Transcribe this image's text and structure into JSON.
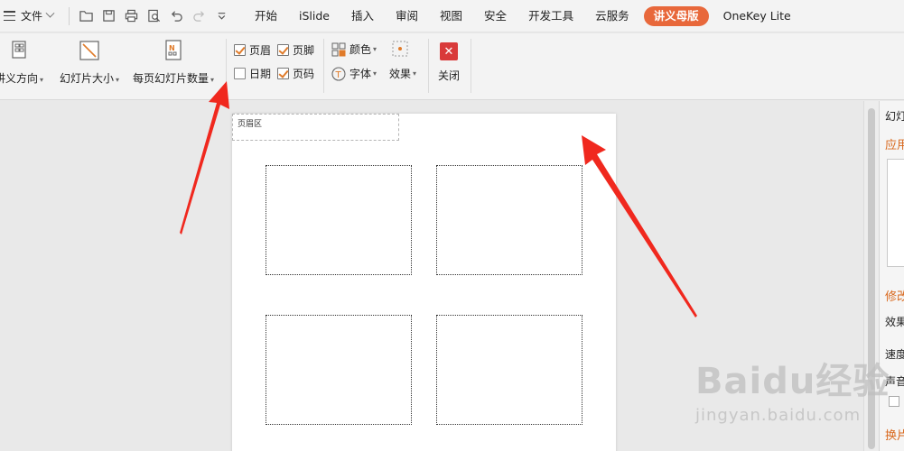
{
  "menubar": {
    "file_label": "文件",
    "quick_icons": [
      "folder-open-icon",
      "save-icon",
      "print-icon",
      "print-preview-icon",
      "undo-icon",
      "redo-icon",
      "customize-dropdown-icon"
    ],
    "tabs": [
      {
        "label": "开始",
        "active": false
      },
      {
        "label": "iSlide",
        "active": false
      },
      {
        "label": "插入",
        "active": false
      },
      {
        "label": "审阅",
        "active": false
      },
      {
        "label": "视图",
        "active": false
      },
      {
        "label": "安全",
        "active": false
      },
      {
        "label": "开发工具",
        "active": false
      },
      {
        "label": "云服务",
        "active": false
      },
      {
        "label": "讲义母版",
        "active": true
      },
      {
        "label": "OneKey Lite",
        "active": false
      }
    ],
    "active_tab_color": "#e8683b"
  },
  "ribbon": {
    "orientation_label": "讲义方向",
    "slide_size_label": "幻灯片大小",
    "slides_per_page_label": "每页幻灯片数量",
    "checkboxes": [
      {
        "label": "页眉",
        "checked": true
      },
      {
        "label": "页脚",
        "checked": true
      },
      {
        "label": "日期",
        "checked": false
      },
      {
        "label": "页码",
        "checked": true
      }
    ],
    "color_label": "颜色",
    "font_label": "字体",
    "effects_label": "效果",
    "close_label": "关闭"
  },
  "canvas": {
    "header_area_label": "页眉区",
    "slot_count": 4
  },
  "side_panel": {
    "title": "幻灯",
    "apply_label": "应用",
    "modify_label": "修改",
    "effect_label": "效果",
    "speed_label": "速度",
    "sound_label": "声音",
    "switch_label": "换片"
  },
  "watermark": {
    "logo": "Baidu经验",
    "url": "jingyan.baidu.com"
  },
  "annotation_color": "#f0281e"
}
